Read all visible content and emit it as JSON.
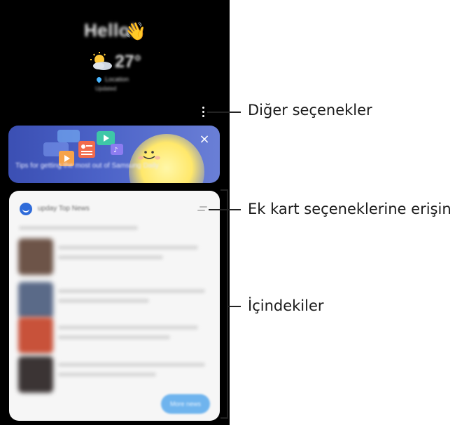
{
  "lockscreen": {
    "greeting": "Hello!",
    "wave_emoji": "👋",
    "temperature": "27°",
    "location": "Location",
    "updated": "Updated"
  },
  "banner": {
    "text": "Tips for getting the most out of Samsung Daily",
    "close_glyph": "×"
  },
  "card": {
    "title": "upday Top News",
    "button_label": "More news"
  },
  "callouts": {
    "more_options": "Diğer seçenekler",
    "card_options": "Ek kart seçeneklerine erişin",
    "contents": "İçindekiler"
  },
  "colors": {
    "banner": "#4c63c8",
    "accent": "#2f6bd9",
    "sun": "#ffe86b"
  }
}
